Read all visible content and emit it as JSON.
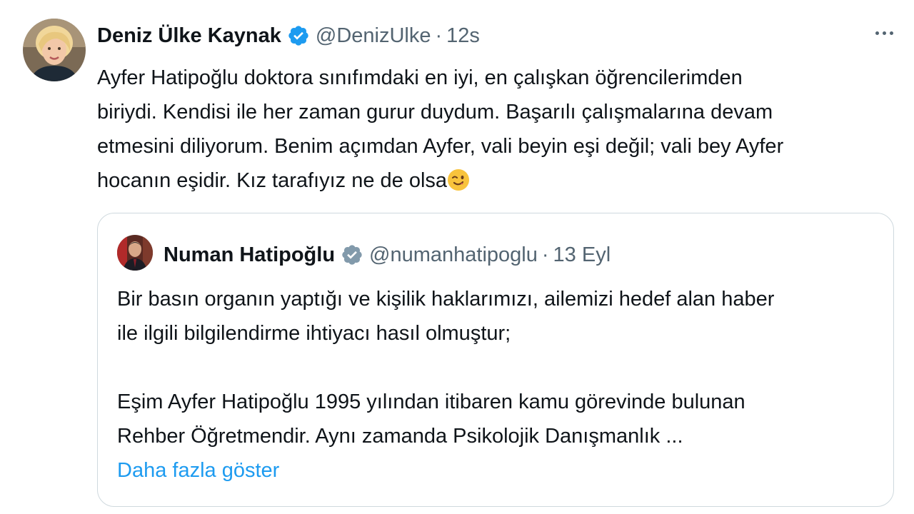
{
  "tweet": {
    "author_name": "Deniz Ülke Kaynak",
    "handle": "@DenizUlke",
    "separator": "·",
    "time": "12s",
    "lines": [
      "Ayfer Hatipoğlu doktora sınıfımdaki en iyi, en çalışkan öğrencilerimden",
      "biriydi. Kendisi ile her zaman gurur duydum. Başarılı çalışmalarına devam",
      "etmesini diliyorum. Benim açımdan Ayfer, vali beyin eşi değil; vali bey Ayfer",
      "hocanın eşidir. Kız tarafıyız ne de olsa"
    ],
    "emoji": "winking-face",
    "verified_color": "#1d9bf0"
  },
  "quote": {
    "author_name": "Numan Hatipoğlu",
    "handle": "@numanhatipoglu",
    "separator": "·",
    "time": "13 Eyl",
    "paragraph1": [
      "Bir basın organın yaptığı ve kişilik haklarımızı, ailemizi hedef alan haber",
      "ile ilgili bilgilendirme ihtiyacı hasıl olmuştur;"
    ],
    "paragraph2": [
      "Eşim Ayfer Hatipoğlu 1995 yılından itibaren kamu görevinde bulunan",
      "Rehber Öğretmendir. Aynı zamanda Psikolojik Danışmanlık ..."
    ],
    "show_more": "Daha fazla göster",
    "verified_color": "#829aab"
  },
  "icons": {
    "more": "more-horizontal-icon",
    "verified": "verified-badge-icon",
    "gov_verified": "gray-verified-badge-icon"
  }
}
